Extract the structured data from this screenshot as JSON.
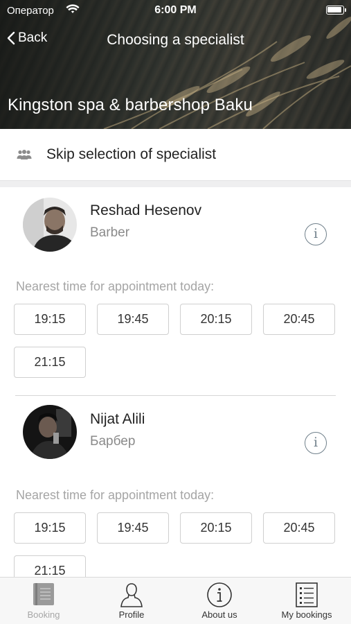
{
  "status_bar": {
    "carrier": "Оператор",
    "time": "6:00 PM"
  },
  "nav": {
    "back_label": "Back",
    "title": "Choosing a specialist"
  },
  "salon": {
    "name": "Kingston spa & barbershop Baku"
  },
  "skip": {
    "label": "Skip selection of specialist",
    "icon": "people-icon"
  },
  "specialists": [
    {
      "name": "Reshad Hesenov",
      "role": "Barber",
      "nearest_label": "Nearest time for appointment today:",
      "slots": [
        "19:15",
        "19:45",
        "20:15",
        "20:45",
        "21:15"
      ]
    },
    {
      "name": "Nijat Alili",
      "role": "Барбер",
      "nearest_label": "Nearest time for appointment today:",
      "slots": [
        "19:15",
        "19:45",
        "20:15",
        "20:45",
        "21:15"
      ]
    }
  ],
  "tabbar": {
    "items": [
      {
        "label": "Booking",
        "icon": "book-icon",
        "active": true
      },
      {
        "label": "Profile",
        "icon": "person-icon",
        "active": false
      },
      {
        "label": "About us",
        "icon": "info-icon",
        "active": false
      },
      {
        "label": "My bookings",
        "icon": "list-icon",
        "active": false
      }
    ]
  },
  "colors": {
    "accent_icon": "#6f7f8a",
    "muted_text": "#a5a5a5",
    "tab_inactive": "#a6a6a6"
  }
}
